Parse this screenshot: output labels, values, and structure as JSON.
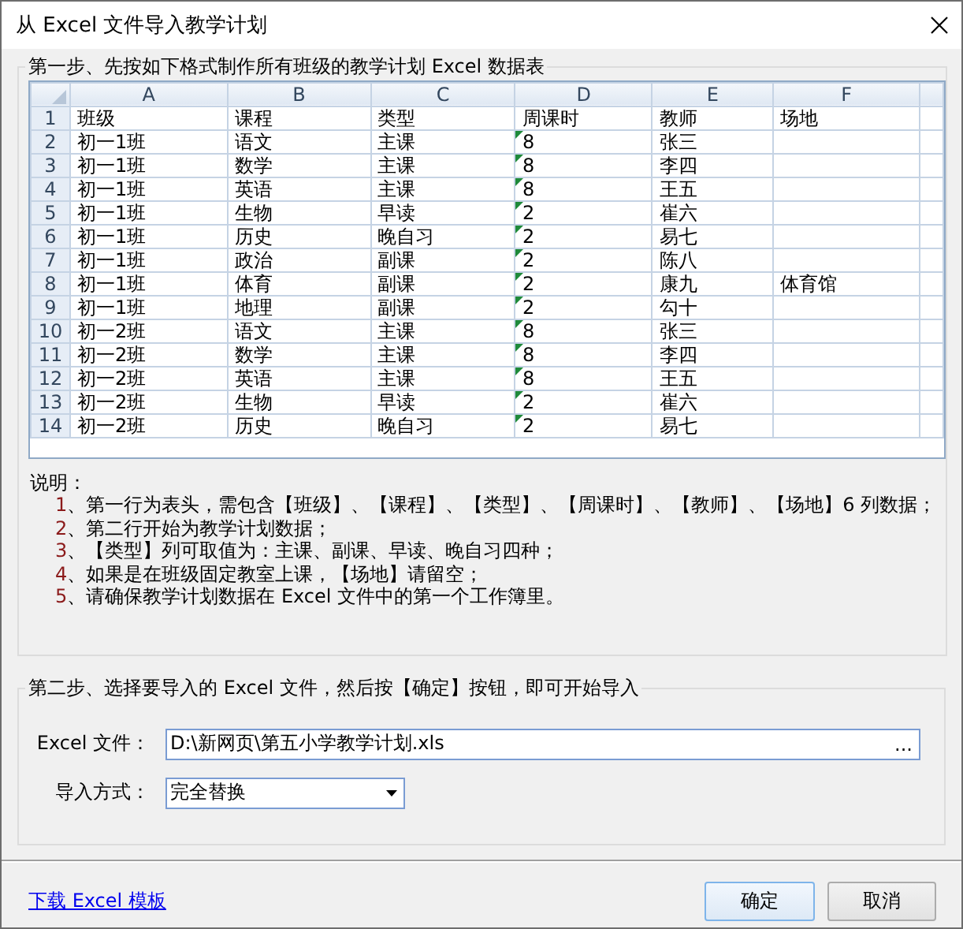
{
  "window": {
    "title": "从 Excel 文件导入教学计划"
  },
  "step1": {
    "title": "第一步、先按如下格式制作所有班级的教学计划 Excel 数据表",
    "sheet": {
      "columns": [
        "A",
        "B",
        "C",
        "D",
        "E",
        "F"
      ],
      "rows": [
        {
          "number": "1",
          "cells": [
            "班级",
            "课程",
            "类型",
            "周课时",
            "教师",
            "场地"
          ],
          "flagged": false
        },
        {
          "number": "2",
          "cells": [
            "初一1班",
            "语文",
            "主课",
            "8",
            "张三",
            ""
          ],
          "flagged": true
        },
        {
          "number": "3",
          "cells": [
            "初一1班",
            "数学",
            "主课",
            "8",
            "李四",
            ""
          ],
          "flagged": true
        },
        {
          "number": "4",
          "cells": [
            "初一1班",
            "英语",
            "主课",
            "8",
            "王五",
            ""
          ],
          "flagged": true
        },
        {
          "number": "5",
          "cells": [
            "初一1班",
            "生物",
            "早读",
            "2",
            "崔六",
            ""
          ],
          "flagged": true
        },
        {
          "number": "6",
          "cells": [
            "初一1班",
            "历史",
            "晚自习",
            "2",
            "易七",
            ""
          ],
          "flagged": true
        },
        {
          "number": "7",
          "cells": [
            "初一1班",
            "政治",
            "副课",
            "2",
            "陈八",
            ""
          ],
          "flagged": true
        },
        {
          "number": "8",
          "cells": [
            "初一1班",
            "体育",
            "副课",
            "2",
            "康九",
            "体育馆"
          ],
          "flagged": true
        },
        {
          "number": "9",
          "cells": [
            "初一1班",
            "地理",
            "副课",
            "2",
            "勾十",
            ""
          ],
          "flagged": true
        },
        {
          "number": "10",
          "cells": [
            "初一2班",
            "语文",
            "主课",
            "8",
            "张三",
            ""
          ],
          "flagged": true
        },
        {
          "number": "11",
          "cells": [
            "初一2班",
            "数学",
            "主课",
            "8",
            "李四",
            ""
          ],
          "flagged": true
        },
        {
          "number": "12",
          "cells": [
            "初一2班",
            "英语",
            "主课",
            "8",
            "王五",
            ""
          ],
          "flagged": true
        },
        {
          "number": "13",
          "cells": [
            "初一2班",
            "生物",
            "早读",
            "2",
            "崔六",
            ""
          ],
          "flagged": true
        },
        {
          "number": "14",
          "cells": [
            "初一2班",
            "历史",
            "晚自习",
            "2",
            "易七",
            ""
          ],
          "flagged": true
        }
      ]
    },
    "notes": {
      "heading": "说明：",
      "items": [
        {
          "number": "1",
          "text": "、第一行为表头，需包含【班级】、【课程】、【类型】、【周课时】、【教师】、【场地】6 列数据；"
        },
        {
          "number": "2",
          "text": "、第二行开始为教学计划数据；"
        },
        {
          "number": "3",
          "text": "、【类型】列可取值为：主课、副课、早读、晚自习四种；"
        },
        {
          "number": "4",
          "text": "、如果是在班级固定教室上课，【场地】请留空；"
        },
        {
          "number": "5",
          "text": "、请确保教学计划数据在 Excel 文件中的第一个工作簿里。"
        }
      ]
    }
  },
  "step2": {
    "title": "第二步、选择要导入的 Excel 文件，然后按【确定】按钮，即可开始导入",
    "file": {
      "label": "Excel 文件：",
      "value": "D:\\新网页\\第五小学教学计划.xls",
      "browse": "..."
    },
    "mode": {
      "label": "导入方式：",
      "value": "完全替换"
    }
  },
  "footer": {
    "link": "下载 Excel 模板",
    "buttons": [
      "确定",
      "取消"
    ]
  }
}
